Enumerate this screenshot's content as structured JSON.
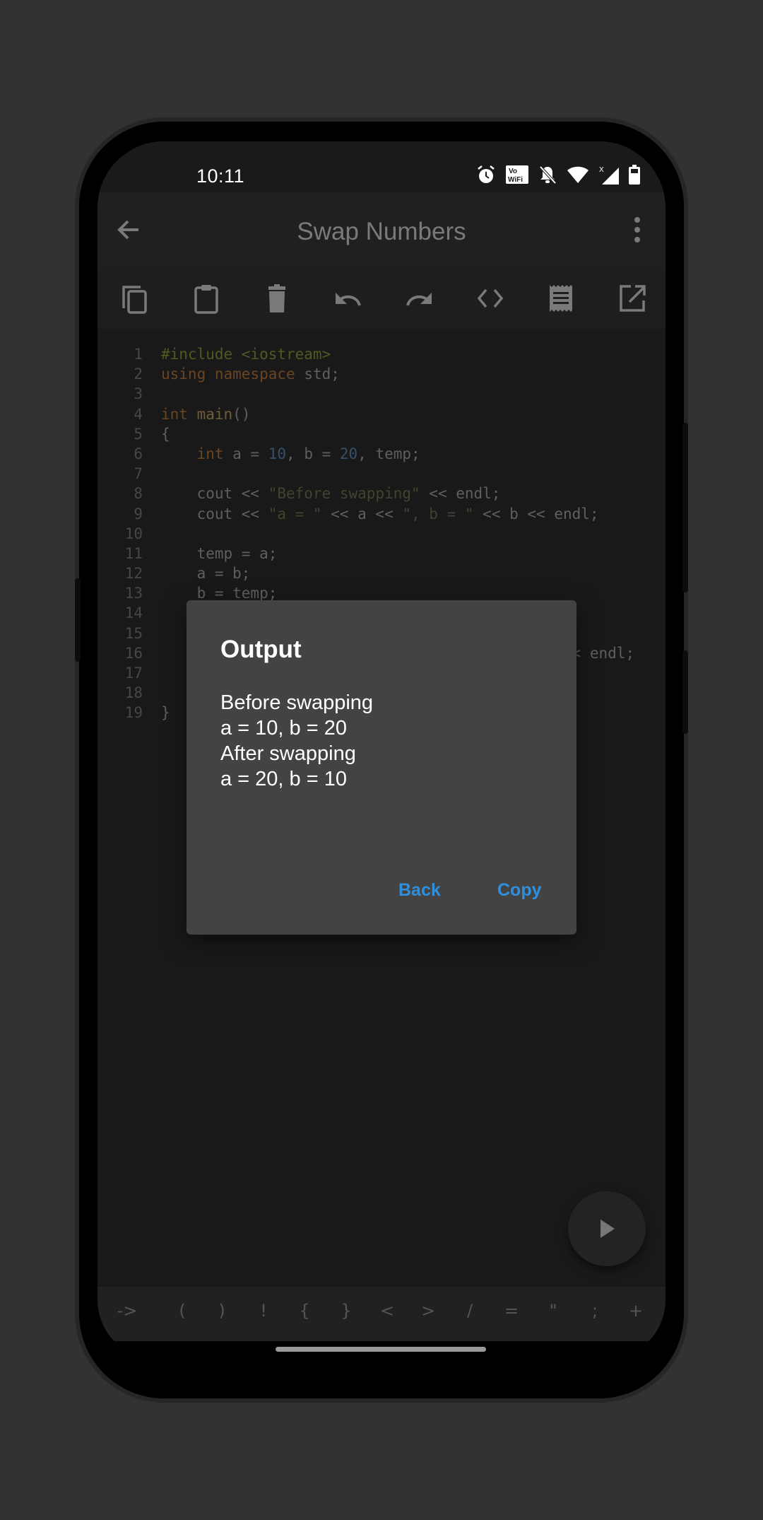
{
  "status_bar": {
    "time": "10:11",
    "icons": [
      "alarm-icon",
      "vowifi-icon",
      "bell-off-icon",
      "wifi-icon",
      "signal-no-data-icon",
      "battery-icon"
    ]
  },
  "app_bar": {
    "title": "Swap Numbers",
    "back_icon": "arrow-left-icon",
    "menu_icon": "more-vertical-icon"
  },
  "toolbar": {
    "items": [
      {
        "name": "copy",
        "icon": "copy-icon"
      },
      {
        "name": "paste",
        "icon": "clipboard-icon"
      },
      {
        "name": "delete",
        "icon": "trash-icon"
      },
      {
        "name": "undo",
        "icon": "undo-icon"
      },
      {
        "name": "redo",
        "icon": "redo-icon"
      },
      {
        "name": "format",
        "icon": "code-icon"
      },
      {
        "name": "notes",
        "icon": "receipt-icon"
      },
      {
        "name": "share",
        "icon": "open-external-icon"
      }
    ]
  },
  "editor": {
    "language": "C++",
    "lines": [
      {
        "n": "1",
        "tokens": [
          [
            "pre",
            "#include <iostream>"
          ]
        ]
      },
      {
        "n": "2",
        "tokens": [
          [
            "kw",
            "using"
          ],
          [
            "plain",
            " "
          ],
          [
            "kw",
            "namespace"
          ],
          [
            "plain",
            " std;"
          ]
        ]
      },
      {
        "n": "3",
        "tokens": []
      },
      {
        "n": "4",
        "tokens": [
          [
            "kw",
            "int"
          ],
          [
            "plain",
            " "
          ],
          [
            "fn",
            "main"
          ],
          [
            "plain",
            "()"
          ]
        ]
      },
      {
        "n": "5",
        "tokens": [
          [
            "plain",
            "{"
          ]
        ]
      },
      {
        "n": "6",
        "tokens": [
          [
            "plain",
            "    "
          ],
          [
            "kw",
            "int"
          ],
          [
            "plain",
            " a = "
          ],
          [
            "num",
            "10"
          ],
          [
            "plain",
            ", b = "
          ],
          [
            "num",
            "20"
          ],
          [
            "plain",
            ", temp;"
          ]
        ]
      },
      {
        "n": "7",
        "tokens": []
      },
      {
        "n": "8",
        "tokens": [
          [
            "plain",
            "    cout << "
          ],
          [
            "str",
            "\"Before swapping\""
          ],
          [
            "plain",
            " << endl;"
          ]
        ]
      },
      {
        "n": "9",
        "tokens": [
          [
            "plain",
            "    cout << "
          ],
          [
            "str",
            "\"a = \""
          ],
          [
            "plain",
            " << a << "
          ],
          [
            "str",
            "\", b = \""
          ],
          [
            "plain",
            " << b << endl;"
          ]
        ]
      },
      {
        "n": "10",
        "tokens": []
      },
      {
        "n": "11",
        "tokens": [
          [
            "plain",
            "    temp = a;"
          ]
        ]
      },
      {
        "n": "12",
        "tokens": [
          [
            "plain",
            "    a = b;"
          ]
        ]
      },
      {
        "n": "13",
        "tokens": [
          [
            "plain",
            "    b = temp;"
          ]
        ]
      },
      {
        "n": "14",
        "tokens": []
      },
      {
        "n": "15",
        "tokens": []
      },
      {
        "n": "16",
        "tokens": [
          [
            "plain",
            "                                             << endl;"
          ]
        ]
      },
      {
        "n": "17",
        "tokens": []
      },
      {
        "n": "18",
        "tokens": []
      },
      {
        "n": "19",
        "tokens": [
          [
            "plain",
            "}"
          ]
        ]
      }
    ]
  },
  "run_button": {
    "icon": "play-icon"
  },
  "symbol_bar": {
    "symbols": [
      "->",
      "(",
      ")",
      "!",
      "{",
      "}",
      "<",
      ">",
      "/",
      "=",
      "\"",
      ";",
      "+"
    ]
  },
  "dialog": {
    "title": "Output",
    "output_lines": [
      "Before swapping",
      "a = 10, b = 20",
      "After swapping",
      "a = 20, b = 10"
    ],
    "back_label": "Back",
    "copy_label": "Copy",
    "accent_color": "#2f8fde"
  }
}
